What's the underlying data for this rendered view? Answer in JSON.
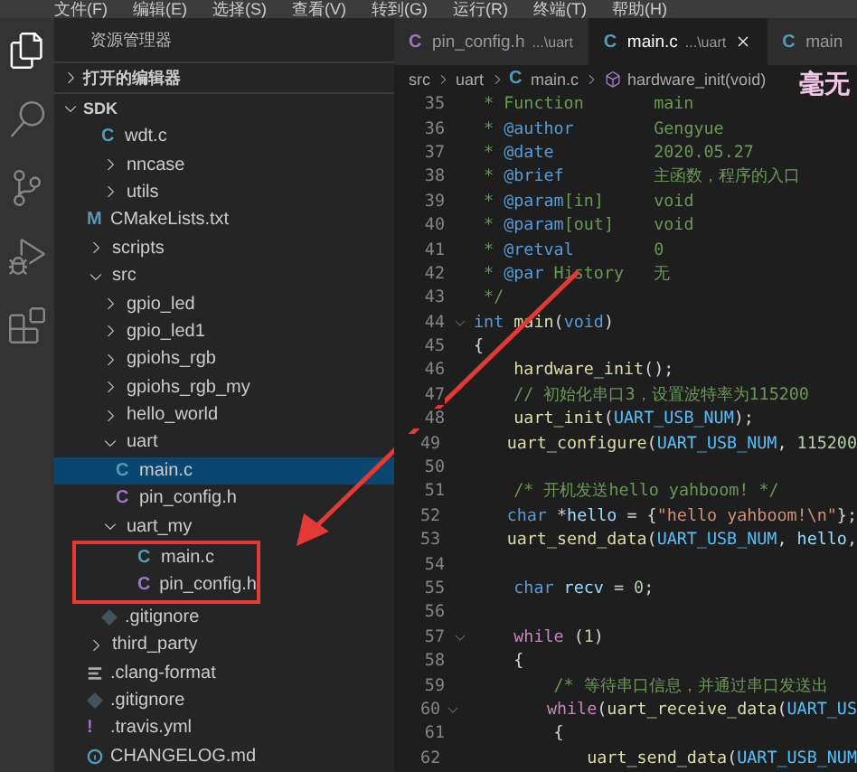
{
  "menu_bar": [
    "文件(F)",
    "编辑(E)",
    "选择(S)",
    "查看(V)",
    "转到(G)",
    "运行(R)",
    "终端(T)",
    "帮助(H)"
  ],
  "sidebar": {
    "title": "资源管理器",
    "sections": [
      {
        "label": "打开的编辑器",
        "expanded": false
      },
      {
        "label": "SDK",
        "expanded": true
      }
    ],
    "tree": [
      {
        "children": [
          {
            "label": "wdt.c",
            "kind": "c",
            "glyph": "C",
            "selected": false
          },
          {
            "label": "nncase",
            "kind": "folder",
            "expanded": false,
            "selected": false
          },
          {
            "label": "utils",
            "kind": "folder",
            "expanded": false,
            "selected": false
          }
        ]
      },
      {
        "label": "CMakeLists.txt",
        "kind": "cmake",
        "glyph": "M",
        "selected": false
      },
      {
        "label": "scripts",
        "kind": "folder",
        "expanded": false,
        "selected": false
      },
      {
        "label": "src",
        "kind": "folder",
        "expanded": true,
        "selected": false,
        "children": [
          {
            "label": "gpio_led",
            "kind": "folder",
            "expanded": false,
            "selected": false
          },
          {
            "label": "gpio_led1",
            "kind": "folder",
            "expanded": false,
            "selected": false
          },
          {
            "label": "gpiohs_rgb",
            "kind": "folder",
            "expanded": false,
            "selected": false
          },
          {
            "label": "gpiohs_rgb_my",
            "kind": "folder",
            "expanded": false,
            "selected": false
          },
          {
            "label": "hello_world",
            "kind": "folder",
            "expanded": false,
            "selected": false
          },
          {
            "label": "uart",
            "kind": "folder",
            "expanded": true,
            "selected": false,
            "children": [
              {
                "label": "main.c",
                "kind": "c",
                "glyph": "C",
                "selected": true
              },
              {
                "label": "pin_config.h",
                "kind": "h",
                "glyph": "C",
                "selected": false
              }
            ]
          },
          {
            "label": "uart_my",
            "kind": "folder",
            "expanded": true,
            "selected": false,
            "highlighted": true,
            "children": [
              {
                "label": "main.c",
                "kind": "c",
                "glyph": "C",
                "selected": false
              },
              {
                "label": "pin_config.h",
                "kind": "h",
                "glyph": "C",
                "selected": false
              }
            ]
          },
          {
            "label": ".gitignore",
            "kind": "git",
            "selected": false
          }
        ]
      },
      {
        "label": "third_party",
        "kind": "folder",
        "expanded": false,
        "selected": false
      },
      {
        "label": ".clang-format",
        "kind": "lines",
        "selected": false
      },
      {
        "label": ".gitignore",
        "kind": "git",
        "selected": false
      },
      {
        "label": ".travis.yml",
        "kind": "yml",
        "glyph": "!",
        "selected": false
      },
      {
        "label": "CHANGELOG.md",
        "kind": "info",
        "selected": false
      }
    ]
  },
  "tabs": [
    {
      "label": "pin_config.h",
      "path": "...\\uart",
      "glyph": "C",
      "kind": "h",
      "selected": false
    },
    {
      "label": "main.c",
      "path": "...\\uart",
      "glyph": "C",
      "kind": "c",
      "selected": true
    },
    {
      "label": "main",
      "glyph": "C",
      "kind": "c",
      "selected": false
    }
  ],
  "overlay_text": "毫无",
  "breadcrumb": [
    {
      "label": "src",
      "kind": "folder"
    },
    {
      "label": "uart",
      "kind": "folder"
    },
    {
      "label": "main.c",
      "kind": "c",
      "glyph": "C"
    },
    {
      "label": "hardware_init(void)",
      "kind": "function"
    }
  ],
  "code": [
    {
      "n": "35",
      "tokens": [
        {
          "t": " * Function       main",
          "kind": "comment"
        }
      ]
    },
    {
      "n": "36",
      "tokens": [
        {
          "t": " * ",
          "kind": "comment"
        },
        {
          "t": "@author",
          "kind": "tag"
        },
        {
          "t": "        Gengyue",
          "kind": "comment"
        }
      ]
    },
    {
      "n": "37",
      "tokens": [
        {
          "t": " * ",
          "kind": "comment"
        },
        {
          "t": "@date",
          "kind": "tag"
        },
        {
          "t": "          2020.05.27",
          "kind": "comment"
        }
      ]
    },
    {
      "n": "38",
      "tokens": [
        {
          "t": " * ",
          "kind": "comment"
        },
        {
          "t": "@brief",
          "kind": "tag"
        },
        {
          "t": "         主函数，程序的入口",
          "kind": "comment"
        }
      ]
    },
    {
      "n": "39",
      "tokens": [
        {
          "t": " * ",
          "kind": "comment"
        },
        {
          "t": "@param",
          "kind": "tag"
        },
        {
          "t": "[in]     void",
          "kind": "comment"
        }
      ]
    },
    {
      "n": "40",
      "tokens": [
        {
          "t": " * ",
          "kind": "comment"
        },
        {
          "t": "@param",
          "kind": "tag"
        },
        {
          "t": "[out]    void",
          "kind": "comment"
        }
      ]
    },
    {
      "n": "41",
      "tokens": [
        {
          "t": " * ",
          "kind": "comment"
        },
        {
          "t": "@retval",
          "kind": "tag"
        },
        {
          "t": "        0",
          "kind": "comment"
        }
      ]
    },
    {
      "n": "42",
      "tokens": [
        {
          "t": " * ",
          "kind": "comment"
        },
        {
          "t": "@par",
          "kind": "tag"
        },
        {
          "t": " History   无",
          "kind": "comment"
        }
      ]
    },
    {
      "n": "43",
      "tokens": [
        {
          "t": " */",
          "kind": "comment"
        }
      ]
    },
    {
      "n": "44",
      "fold": true,
      "tokens": [
        {
          "t": "int",
          "kind": "keyword"
        },
        {
          "t": " main",
          "kind": "function"
        },
        {
          "t": "(",
          "kind": "plain"
        },
        {
          "t": "void",
          "kind": "keyword"
        },
        {
          "t": ")",
          "kind": "plain"
        }
      ]
    },
    {
      "n": "45",
      "tokens": [
        {
          "t": "{",
          "kind": "plain"
        }
      ]
    },
    {
      "n": "46",
      "tokens": [
        {
          "t": "    hardware_init",
          "kind": "function"
        },
        {
          "t": "();",
          "kind": "plain"
        }
      ]
    },
    {
      "n": "47",
      "tokens": [
        {
          "t": "    // 初始化串口3，设置波特率为115200",
          "kind": "comment"
        }
      ]
    },
    {
      "n": "48",
      "tokens": [
        {
          "t": "    uart_init",
          "kind": "function"
        },
        {
          "t": "(",
          "kind": "plain"
        },
        {
          "t": "UART_USB_NUM",
          "kind": "constant"
        },
        {
          "t": ");",
          "kind": "plain"
        }
      ]
    },
    {
      "n": "49",
      "tokens": [
        {
          "t": "    uart_configure",
          "kind": "function"
        },
        {
          "t": "(",
          "kind": "plain"
        },
        {
          "t": "UART_USB_NUM",
          "kind": "constant"
        },
        {
          "t": ", ",
          "kind": "plain"
        },
        {
          "t": "115200",
          "kind": "number"
        }
      ]
    },
    {
      "n": "50"
    },
    {
      "n": "51",
      "tokens": [
        {
          "t": "    /* 开机发送hello yahboom! */",
          "kind": "comment"
        }
      ]
    },
    {
      "n": "52",
      "tokens": [
        {
          "t": "    char",
          "kind": "keyword"
        },
        {
          "t": " *",
          "kind": "plain"
        },
        {
          "t": "hello",
          "kind": "variable"
        },
        {
          "t": " = {",
          "kind": "plain"
        },
        {
          "t": "\"hello yahboom!\\n\"",
          "kind": "string"
        },
        {
          "t": "};",
          "kind": "plain"
        }
      ]
    },
    {
      "n": "53",
      "tokens": [
        {
          "t": "    uart_send_data",
          "kind": "function"
        },
        {
          "t": "(",
          "kind": "plain"
        },
        {
          "t": "UART_USB_NUM",
          "kind": "constant"
        },
        {
          "t": ", ",
          "kind": "plain"
        },
        {
          "t": "hello",
          "kind": "variable"
        },
        {
          "t": ",",
          "kind": "plain"
        }
      ]
    },
    {
      "n": "54"
    },
    {
      "n": "55",
      "tokens": [
        {
          "t": "    char",
          "kind": "keyword"
        },
        {
          "t": " recv",
          "kind": "variable"
        },
        {
          "t": " = ",
          "kind": "plain"
        },
        {
          "t": "0",
          "kind": "number"
        },
        {
          "t": ";",
          "kind": "plain"
        }
      ]
    },
    {
      "n": "56"
    },
    {
      "n": "57",
      "fold": true,
      "tokens": [
        {
          "t": "    while",
          "kind": "control"
        },
        {
          "t": " (",
          "kind": "plain"
        },
        {
          "t": "1",
          "kind": "number"
        },
        {
          "t": ")",
          "kind": "plain"
        }
      ]
    },
    {
      "n": "58",
      "tokens": [
        {
          "t": "    {",
          "kind": "plain"
        }
      ]
    },
    {
      "n": "59",
      "tokens": [
        {
          "t": "        /* 等待串口信息，并通过串口发送出",
          "kind": "comment"
        }
      ]
    },
    {
      "n": "60",
      "fold": true,
      "tokens": [
        {
          "t": "        while",
          "kind": "control"
        },
        {
          "t": "(",
          "kind": "plain"
        },
        {
          "t": "uart_receive_data",
          "kind": "function"
        },
        {
          "t": "(",
          "kind": "plain"
        },
        {
          "t": "UART_US",
          "kind": "constant"
        }
      ]
    },
    {
      "n": "61",
      "tokens": [
        {
          "t": "        {",
          "kind": "plain"
        }
      ]
    },
    {
      "n": "62",
      "tokens": [
        {
          "t": "            uart_send_data",
          "kind": "function"
        },
        {
          "t": "(",
          "kind": "plain"
        },
        {
          "t": "UART_USB_NUM",
          "kind": "constant"
        }
      ]
    }
  ]
}
